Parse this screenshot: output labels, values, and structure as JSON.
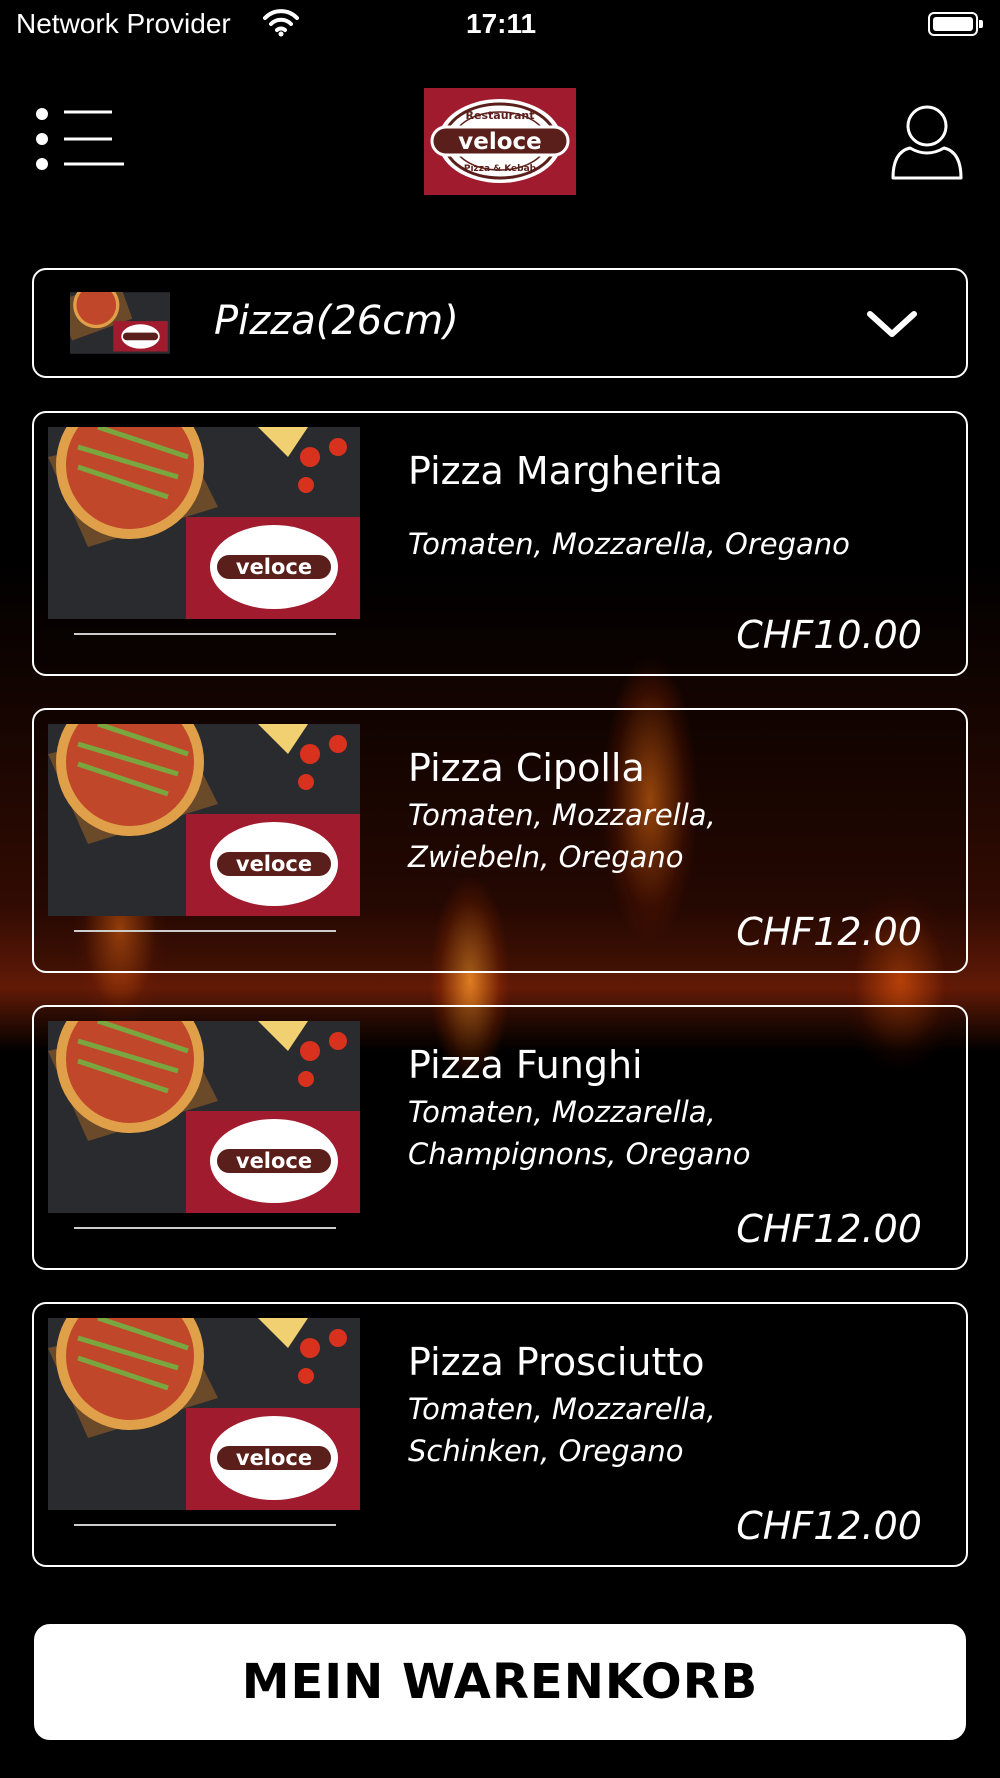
{
  "status_bar": {
    "carrier": "Network Provider",
    "time": "17:11",
    "wifi_icon": "wifi-icon",
    "battery_icon": "battery-icon"
  },
  "header": {
    "menu_icon": "menu-list-icon",
    "logo": {
      "top_text": "Restaurant",
      "name": "veloce",
      "bottom_text": "Pizza & Kebab"
    },
    "user_icon": "user-icon"
  },
  "category": {
    "label": "Pizza(26cm)",
    "chevron_icon": "chevron-down-icon"
  },
  "items": [
    {
      "name": "Pizza Margherita",
      "description": [
        "Tomaten, Mozzarella, Oregano"
      ],
      "price": "CHF10.00"
    },
    {
      "name": "Pizza Cipolla",
      "description": [
        "Tomaten, Mozzarella,",
        "Zwiebeln, Oregano"
      ],
      "price": "CHF12.00"
    },
    {
      "name": "Pizza Funghi",
      "description": [
        "Tomaten, Mozzarella,",
        "Champignons, Oregano"
      ],
      "price": "CHF12.00"
    },
    {
      "name": "Pizza Prosciutto",
      "description": [
        "Tomaten, Mozzarella,",
        "Schinken, Oregano"
      ],
      "price": "CHF12.00"
    }
  ],
  "cart_button": {
    "label": "MEIN WARENKORB"
  },
  "colors": {
    "background": "#000000",
    "brand_red": "#a11b2e",
    "logo_brown": "#5a1f1a",
    "button_bg": "#ffffff"
  }
}
